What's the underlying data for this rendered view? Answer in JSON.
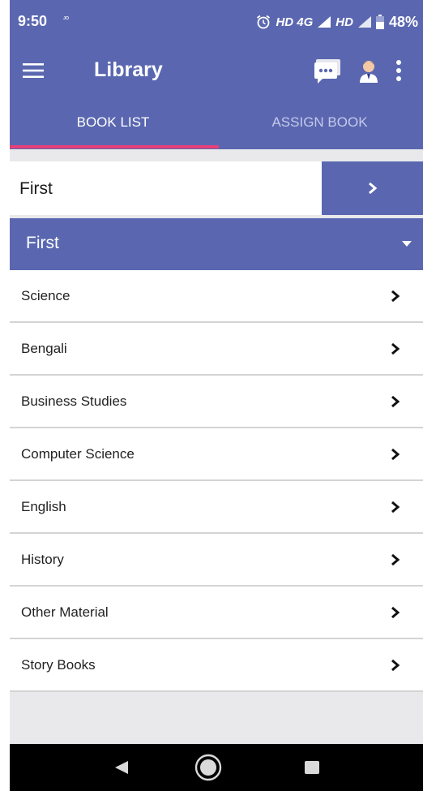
{
  "status_bar": {
    "time": "9:50",
    "carrier_mark": "JIO",
    "network_1": "HD 4G",
    "network_2": "HD",
    "battery_percent": "48%"
  },
  "app_bar": {
    "title": "Library",
    "icons": [
      "menu-icon",
      "chat-icon",
      "user-icon",
      "more-vert-icon"
    ]
  },
  "tabs": [
    {
      "label": "BOOK LIST",
      "active": true
    },
    {
      "label": "ASSIGN BOOK",
      "active": false
    }
  ],
  "selector": {
    "value": "First"
  },
  "group": {
    "title": "First"
  },
  "subjects": [
    "Science",
    "Bengali",
    "Business Studies",
    "Computer Science",
    "English",
    "History",
    "Other Material",
    "Story Books"
  ],
  "colors": {
    "primary": "#5a67b0",
    "tab_indicator": "#e8407a",
    "background": "#e9e9ec"
  }
}
